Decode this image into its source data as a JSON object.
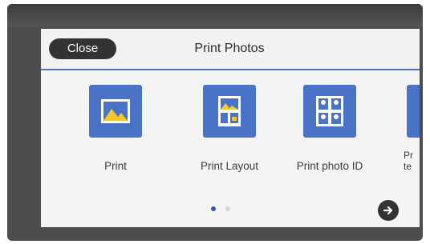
{
  "header": {
    "close_label": "Close",
    "title": "Print Photos"
  },
  "tiles": [
    {
      "label": "Print",
      "icon": "photo-icon"
    },
    {
      "label": "Print Layout",
      "icon": "layout-icon"
    },
    {
      "label": "Print photo ID",
      "icon": "photo-id-icon"
    },
    {
      "label": "Pr\nte",
      "icon": "partial-icon"
    }
  ],
  "pagination": {
    "current_page": 1,
    "total_pages": 2
  },
  "colors": {
    "accent": "#4a73c8",
    "header_rule": "#4a73b8",
    "button_dark": "#333333",
    "dot_active": "#2e5aa8",
    "dot_inactive": "#d6d6d6"
  }
}
